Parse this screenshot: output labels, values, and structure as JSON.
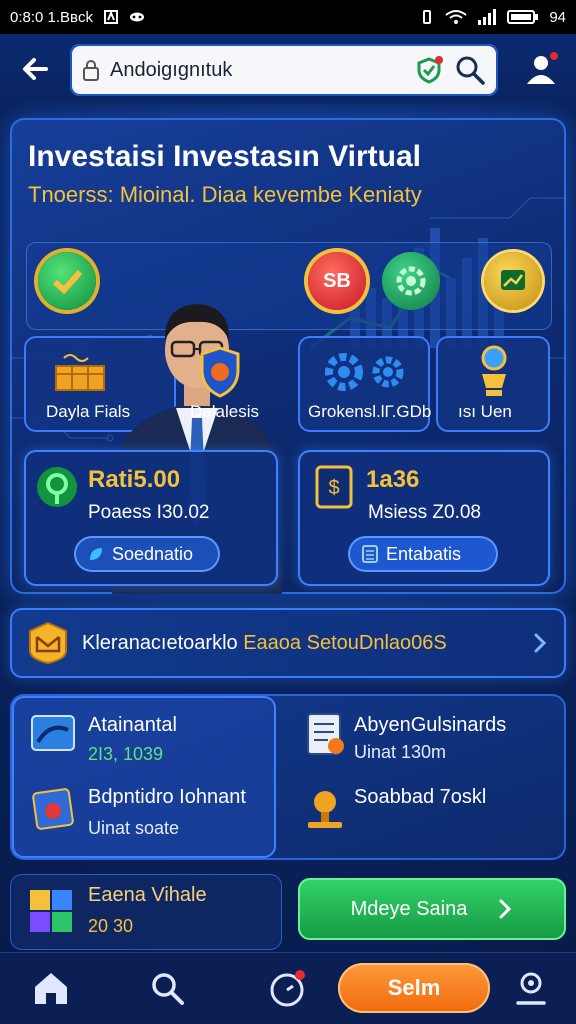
{
  "status_bar": {
    "left_text": "0:8:0 1.Bвck",
    "battery": "94"
  },
  "address_bar": {
    "url": "Andoigıgnıtuk"
  },
  "hero": {
    "title": "Investaisi Investasın Virtual",
    "subtitle": "Tnoerss: Mioinal. Diaa kevembe Keniaty",
    "coin_red_label": "SB",
    "tiles": [
      {
        "label": "Dayla Fials",
        "icon": "gold-bars-icon"
      },
      {
        "label": "Dalalesis",
        "icon": "shield-icon"
      },
      {
        "label": "Grokensl.lГ.GDb",
        "icon": "gears-icon"
      },
      {
        "label": "ısı Uen",
        "icon": "trophy-icon"
      }
    ],
    "stats": [
      {
        "value": "Rati5.00",
        "sub": "Poaess I30.02",
        "button": "Soednatio",
        "icon": "location-pin-icon"
      },
      {
        "value": "1a36",
        "sub": "Msiess Z0.08",
        "button": "Entabatis",
        "icon": "dollar-card-icon"
      }
    ]
  },
  "promo": {
    "text_white": "Kleranacıetoarklo",
    "text_gold": "Eaaoa SetouDnlao06S"
  },
  "panel": {
    "items": [
      {
        "title": "Atainantal",
        "value": "2I3, 1039",
        "value_color": "green",
        "icon": "screen-icon"
      },
      {
        "title": "AbyenGulsinards",
        "value": "Uinat 130m",
        "icon": "document-icon"
      },
      {
        "title": "Bdpntidro Iohnant",
        "value": "Uinat soate",
        "icon": "gift-card-icon"
      },
      {
        "title": "Soabbad 7oskl",
        "value": "",
        "icon": "microphone-icon"
      }
    ]
  },
  "bottom": {
    "card_title": "Eaena Vihale",
    "card_value": "20 30",
    "cta_label": "Mdeye Saina"
  },
  "nav": {
    "sell_label": "Selm"
  },
  "colors": {
    "accent_gold": "#f5c03a",
    "accent_green": "#34d26a",
    "accent_orange": "#f07a1c",
    "panel_blue": "#123a8e"
  }
}
